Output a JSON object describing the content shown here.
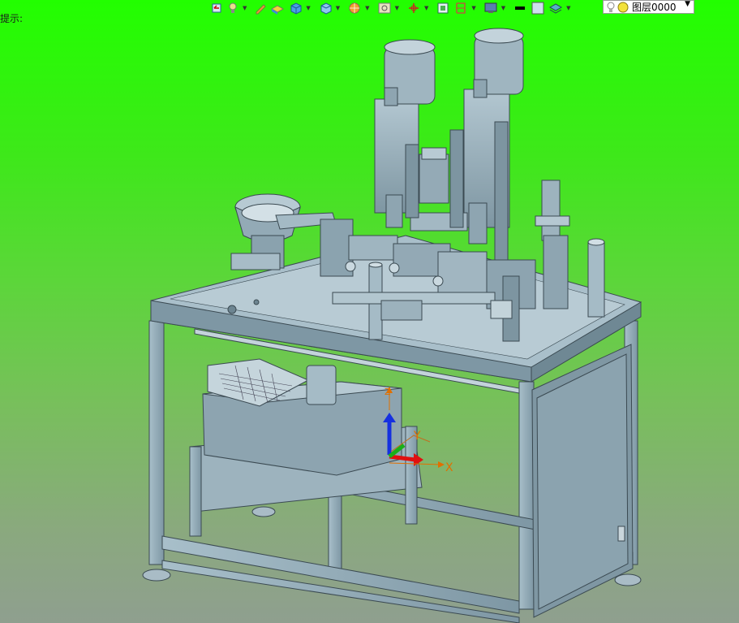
{
  "status": {
    "hint": "提示:"
  },
  "toolbar": {
    "icons": [
      "undo-icon",
      "lamp-icon",
      "pen-icon",
      "box-solid-icon",
      "cube-icon",
      "view-cube-icon",
      "render-sphere-icon",
      "zoom-icon",
      "axis-icon",
      "frame-icon",
      "section-icon",
      "display-icon",
      "line-color-icon",
      "fill-color-icon",
      "layer-stack-icon"
    ],
    "layer_value": "图层0000"
  },
  "viewport": {
    "axis_x_label": "X",
    "axis_y_label": "Y",
    "axis_z_label": "Z",
    "model_color": "#8fa7b3",
    "background_top": "#22ff00",
    "background_bottom": "#8f9f8f"
  }
}
